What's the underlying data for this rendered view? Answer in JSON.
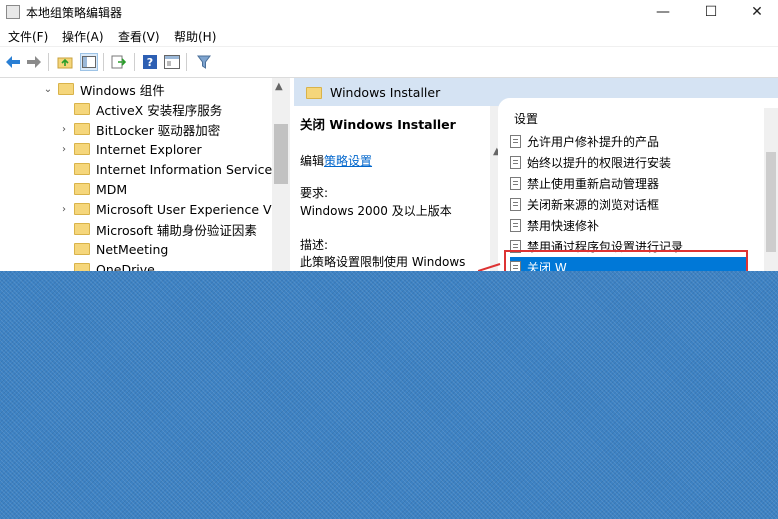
{
  "window": {
    "title": "本地组策略编辑器"
  },
  "titlebar": {
    "minimize": "—",
    "maximize": "☐",
    "close": "✕"
  },
  "menu": [
    "文件(F)",
    "操作(A)",
    "查看(V)",
    "帮助(H)"
  ],
  "toolbar": {
    "icons": [
      "back-icon",
      "forward-icon",
      "up-folder-icon",
      "show-tree-icon",
      "export-icon",
      "help-icon",
      "properties-icon",
      "filter-icon"
    ]
  },
  "tree": {
    "items": [
      {
        "label": "Windows 组件",
        "expanded": true
      },
      {
        "label": "ActiveX 安装程序服务",
        "expanded": false
      },
      {
        "label": "BitLocker 驱动器加密",
        "expanded": false
      },
      {
        "label": "Internet Explorer",
        "expanded": false
      },
      {
        "label": "Internet Information Services",
        "expanded": false
      },
      {
        "label": "MDM",
        "expanded": false
      },
      {
        "label": "Microsoft User Experience Vi",
        "expanded": false
      },
      {
        "label": "Microsoft 辅助身份验证因素",
        "expanded": false
      },
      {
        "label": "NetMeeting",
        "expanded": false
      },
      {
        "label": "OneDrive",
        "expanded": false
      }
    ]
  },
  "right_header": {
    "title": "Windows Installer"
  },
  "description": {
    "policy_title": "关闭 Windows Installer",
    "edit_prefix": "编辑",
    "edit_link": "策略设置",
    "requirement_label": "要求:",
    "requirement_value": "Windows 2000 及以上版本",
    "description_label": "描述:",
    "description_text": "此策略设置限制使用 Windows"
  },
  "list": {
    "column_header": "设置",
    "rows": [
      {
        "label": "允许用户修补提升的产品"
      },
      {
        "label": "始终以提升的权限进行安装"
      },
      {
        "label": "禁止使用重新启动管理器"
      },
      {
        "label": "关闭新来源的浏览对话框"
      },
      {
        "label": "禁用快速修补"
      },
      {
        "label": "禁用通过程序包设置进行记录"
      },
      {
        "label": "关闭 W"
      }
    ]
  },
  "colors": {
    "selection": "#0078d7",
    "header_bg": "#d5e3f3",
    "highlight_box": "#dd3333",
    "overlay": "#3d82c4"
  }
}
